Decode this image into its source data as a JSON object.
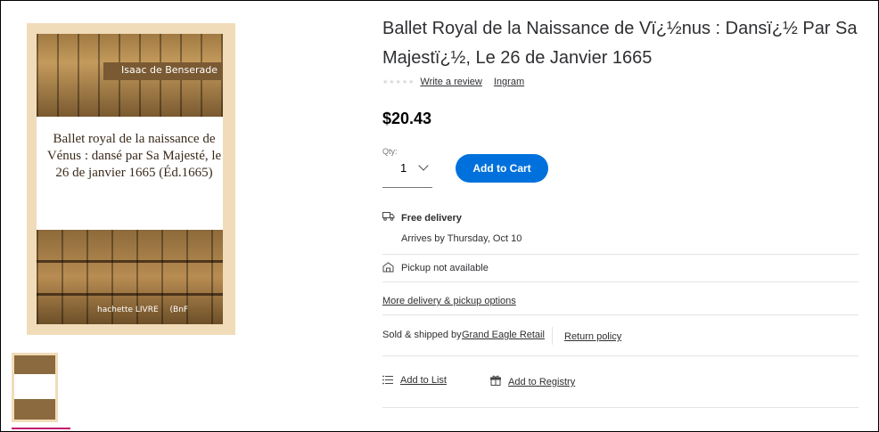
{
  "cover": {
    "author": "Isaac de Benserade",
    "title": "Ballet royal de la naissance de Vénus : dansé par Sa Majesté, le 26 de janvier 1665 (Éd.1665)",
    "publisher_logo": "hachette LIVRE",
    "bnf_logo": "(BnF"
  },
  "product": {
    "title": "Ballet Royal de la Naissance de Vï¿½nus : Dansï¿½ Par Sa Majestï¿½, Le 26 de Janvier 1665",
    "stars": "★★★★★",
    "write_review": "Write a review",
    "brand": "Ingram",
    "price": "$20.43",
    "qty_label": "Qty:",
    "qty_value": "1",
    "add_to_cart": "Add to Cart"
  },
  "fulfillment": {
    "delivery_title": "Free delivery",
    "delivery_date": "Arrives by Thursday, Oct 10",
    "pickup": "Pickup not available",
    "more_options": "More delivery & pickup options"
  },
  "seller": {
    "sold_by_label": "Sold & shipped by",
    "seller_name": "Grand Eagle Retail",
    "return_policy": "Return policy"
  },
  "actions": {
    "add_to_list": "Add to List",
    "add_to_registry": "Add to Registry"
  },
  "icons": {
    "delivery": "truck-icon",
    "pickup": "store-icon",
    "list": "list-icon",
    "registry": "gift-icon"
  },
  "colors": {
    "accent": "#0071dc",
    "thumb_indicator": "#c2196f"
  }
}
